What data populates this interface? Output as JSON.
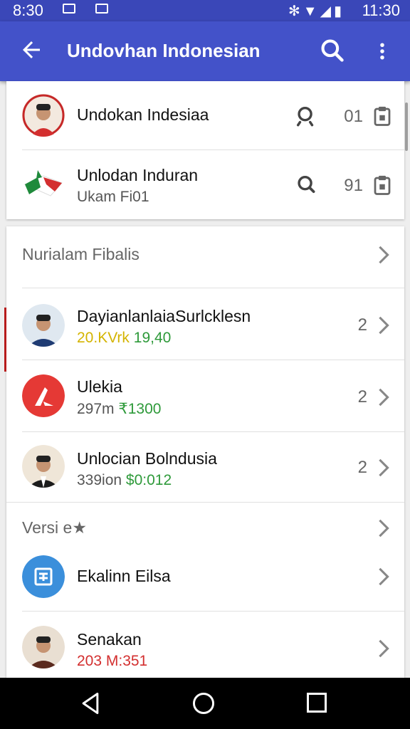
{
  "status_bar": {
    "time_left": "8:30",
    "time_right": "11:30"
  },
  "app_bar": {
    "title": "Undovhan Indonesian"
  },
  "top_card": {
    "items": [
      {
        "name": "Undokan Indesiaa",
        "count": "01"
      },
      {
        "name": "Unlodan Induran",
        "subtitle": "Ukam Fi01",
        "count": "91"
      }
    ]
  },
  "list": {
    "section1": "Nurialam Fibalis",
    "items": [
      {
        "name": "DayianlanlaiaSurlcklesn",
        "sub_a": "20.KVrk",
        "sub_b": "19,40",
        "count": "2"
      },
      {
        "name": "Ulekia",
        "sub_a": "297m",
        "sub_b": "₹1300",
        "count": "2"
      },
      {
        "name": "Unlocian Bolndusia",
        "sub_a": "339ion",
        "sub_b": "$0:012",
        "count": "2"
      }
    ],
    "section2": "Versi e★",
    "items2": [
      {
        "name": "Ekalinn Eilsa"
      },
      {
        "name": "Senakan",
        "sub": "203 M:351"
      }
    ]
  },
  "colors": {
    "app_bar": "#4352c9",
    "status_bar": "#3a47b8",
    "accent_green": "#2e9a3a",
    "accent_amber": "#d4b400",
    "accent_red": "#d32f2f"
  }
}
